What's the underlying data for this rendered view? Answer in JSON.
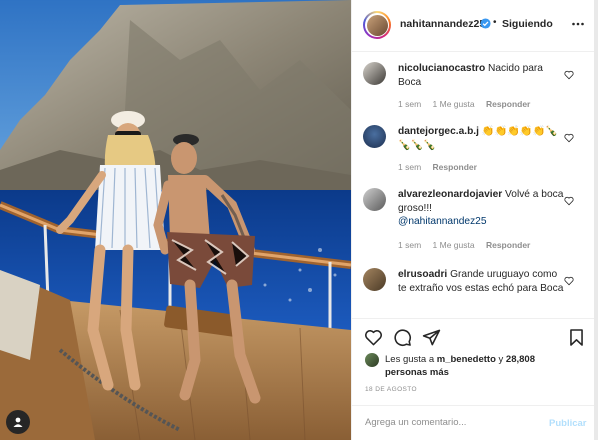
{
  "post": {
    "owner": "nahitannandez25",
    "follow_label": "Siguiendo",
    "dot": "•"
  },
  "comments": [
    {
      "user": "nicolucianocastro",
      "text": "Nacido para Boca",
      "time": "1 sem",
      "likes": "1 Me gusta",
      "reply": "Responder"
    },
    {
      "user": "dantejorgec.a.b.j",
      "text": "👏👏👏👏👏🍾🍾🍾🍾",
      "time": "1 sem",
      "reply": "Responder"
    },
    {
      "user": "alvarezleonardojavier",
      "text": "Volvé a boca groso!!!",
      "mention": "@nahitannandez25",
      "time": "1 sem",
      "likes": "1 Me gusta",
      "reply": "Responder"
    },
    {
      "user": "elrusoadri",
      "text": "Grande uruguayo como te extraño vos estas echó para Boca"
    }
  ],
  "likes": {
    "prefix": "Les gusta a",
    "user": "m_benedetto",
    "conj": "y",
    "count": "28,808 personas más"
  },
  "date": "18 DE AGOSTO",
  "composer": {
    "placeholder": "Agrega un comentario...",
    "publish_label": "Publicar"
  },
  "colors": {
    "link": "#00376b",
    "muted": "#8e8e8e",
    "verified": "#3897f0",
    "publish_disabled": "#b2dffc"
  },
  "icons": {
    "actions": [
      "heart-icon",
      "comment-icon",
      "share-icon",
      "bookmark-icon"
    ],
    "header": [
      "verified-icon",
      "more-options-icon"
    ]
  }
}
